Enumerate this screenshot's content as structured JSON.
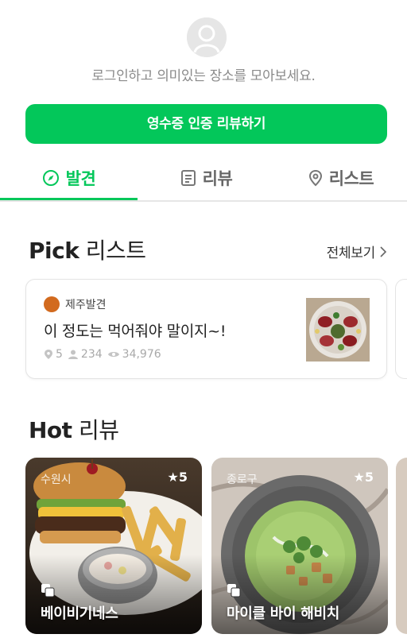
{
  "profile": {
    "login_message": "로그인하고 의미있는 장소를 모아보세요."
  },
  "actions": {
    "receipt_review_label": "영수증 인증 리뷰하기"
  },
  "tabs": [
    {
      "label": "발견",
      "icon": "compass-icon",
      "active": true
    },
    {
      "label": "리뷰",
      "icon": "document-icon",
      "active": false
    },
    {
      "label": "리스트",
      "icon": "location-pin-icon",
      "active": false
    }
  ],
  "pick": {
    "title_en": "Pick",
    "title_ko": "리스트",
    "more_label": "전체보기",
    "card": {
      "author": "제주발견",
      "title": "이 정도는 먹어줘야 말이지~!",
      "places": "5",
      "saves": "234",
      "views": "34,976"
    }
  },
  "hot": {
    "title_en": "Hot",
    "title_ko": "리뷰",
    "items": [
      {
        "region": "수원시",
        "rating": "★5",
        "name": "베이비기네스"
      },
      {
        "region": "종로구",
        "rating": "★5",
        "name": "마이클 바이 해비치"
      }
    ]
  },
  "colors": {
    "accent": "#03c75a",
    "muted_text": "#8a8a8a"
  }
}
